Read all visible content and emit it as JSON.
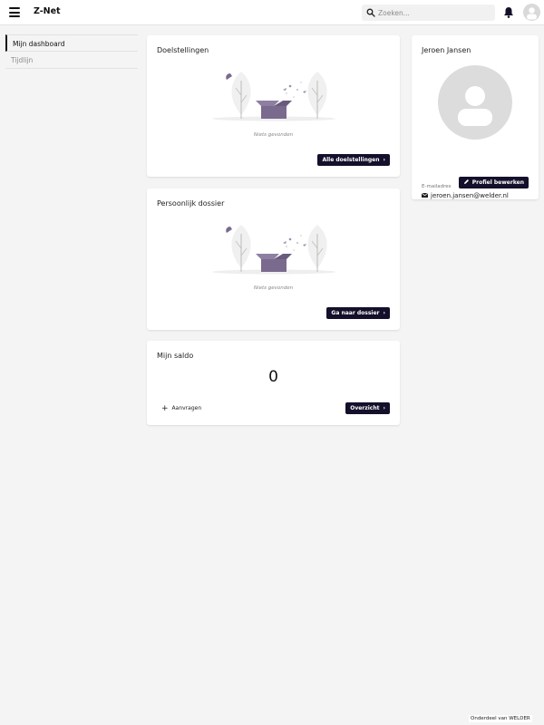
{
  "topbar": {
    "brand": "Z-Net",
    "search_placeholder": "Zoeken..."
  },
  "sidebar": {
    "items": [
      {
        "label": "Mijn dashboard",
        "active": true
      },
      {
        "label": "Tijdlijn",
        "active": false
      }
    ]
  },
  "goals": {
    "title": "Doelstellingen",
    "empty_text": "Niets gevonden",
    "button": "Alle doelstellingen"
  },
  "dossier": {
    "title": "Persoonlijk dossier",
    "empty_text": "Niets gevonden",
    "button": "Ga naar dossier"
  },
  "saldo": {
    "title": "Mijn saldo",
    "value": "0",
    "request_label": "Aanvragen",
    "button": "Overzicht"
  },
  "profile": {
    "name": "Jeroen Jansen",
    "email_label": "E-mailadres",
    "email": "jeroen.jansen@welder.nl",
    "edit_button": "Profiel bewerken"
  },
  "footer": {
    "text": "Onderdeel van WELDER"
  },
  "colors": {
    "button_bg": "#14102b",
    "illustration_accent": "#7a6a8e"
  },
  "icons": [
    "menu-icon",
    "search-icon",
    "bell-icon",
    "avatar",
    "chevron-right-icon",
    "plus-icon",
    "pencil-icon",
    "envelope-icon",
    "empty-box-illustration"
  ]
}
